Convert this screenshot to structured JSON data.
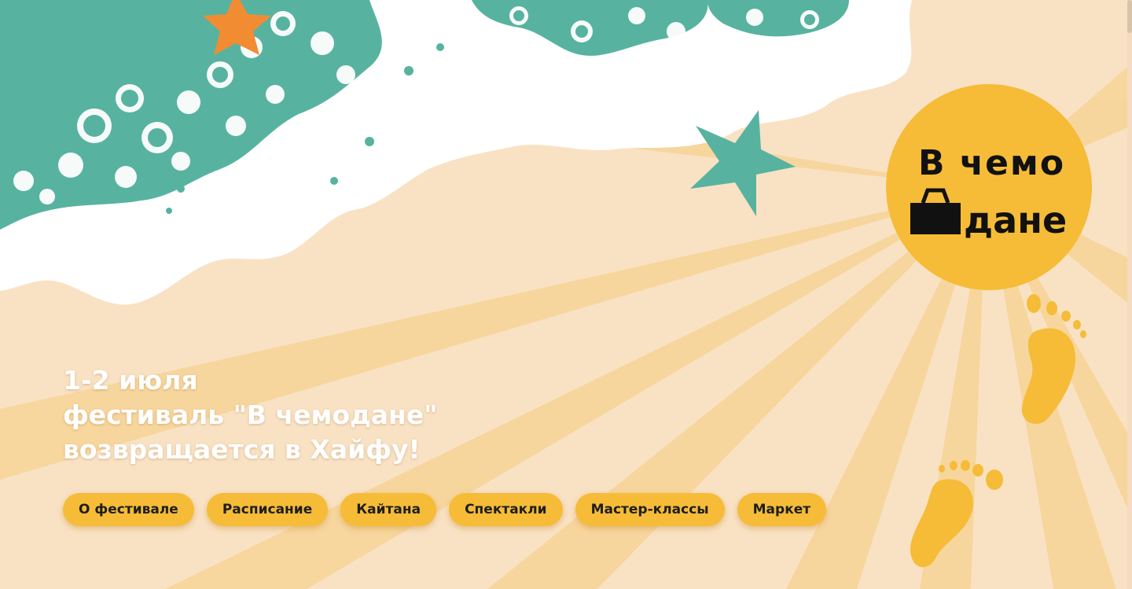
{
  "hero": {
    "line1": "1-2 июля",
    "line2": "фестиваль \"В чемодане\"",
    "line3": "возвращается в Хайфу!"
  },
  "nav": [
    {
      "label": "О фестивале"
    },
    {
      "label": "Расписание"
    },
    {
      "label": "Кайтана"
    },
    {
      "label": "Спектакли"
    },
    {
      "label": "Мастер-классы"
    },
    {
      "label": "Маркет"
    }
  ],
  "logo": {
    "line1": "В чемо",
    "line2": "дане"
  },
  "colors": {
    "background": "#f9e2c4",
    "sea": "#57b3a0",
    "sun": "#f6bc38",
    "rays": "#f7d598",
    "starfish_orange": "#f28c33",
    "text": "#ffffff"
  }
}
